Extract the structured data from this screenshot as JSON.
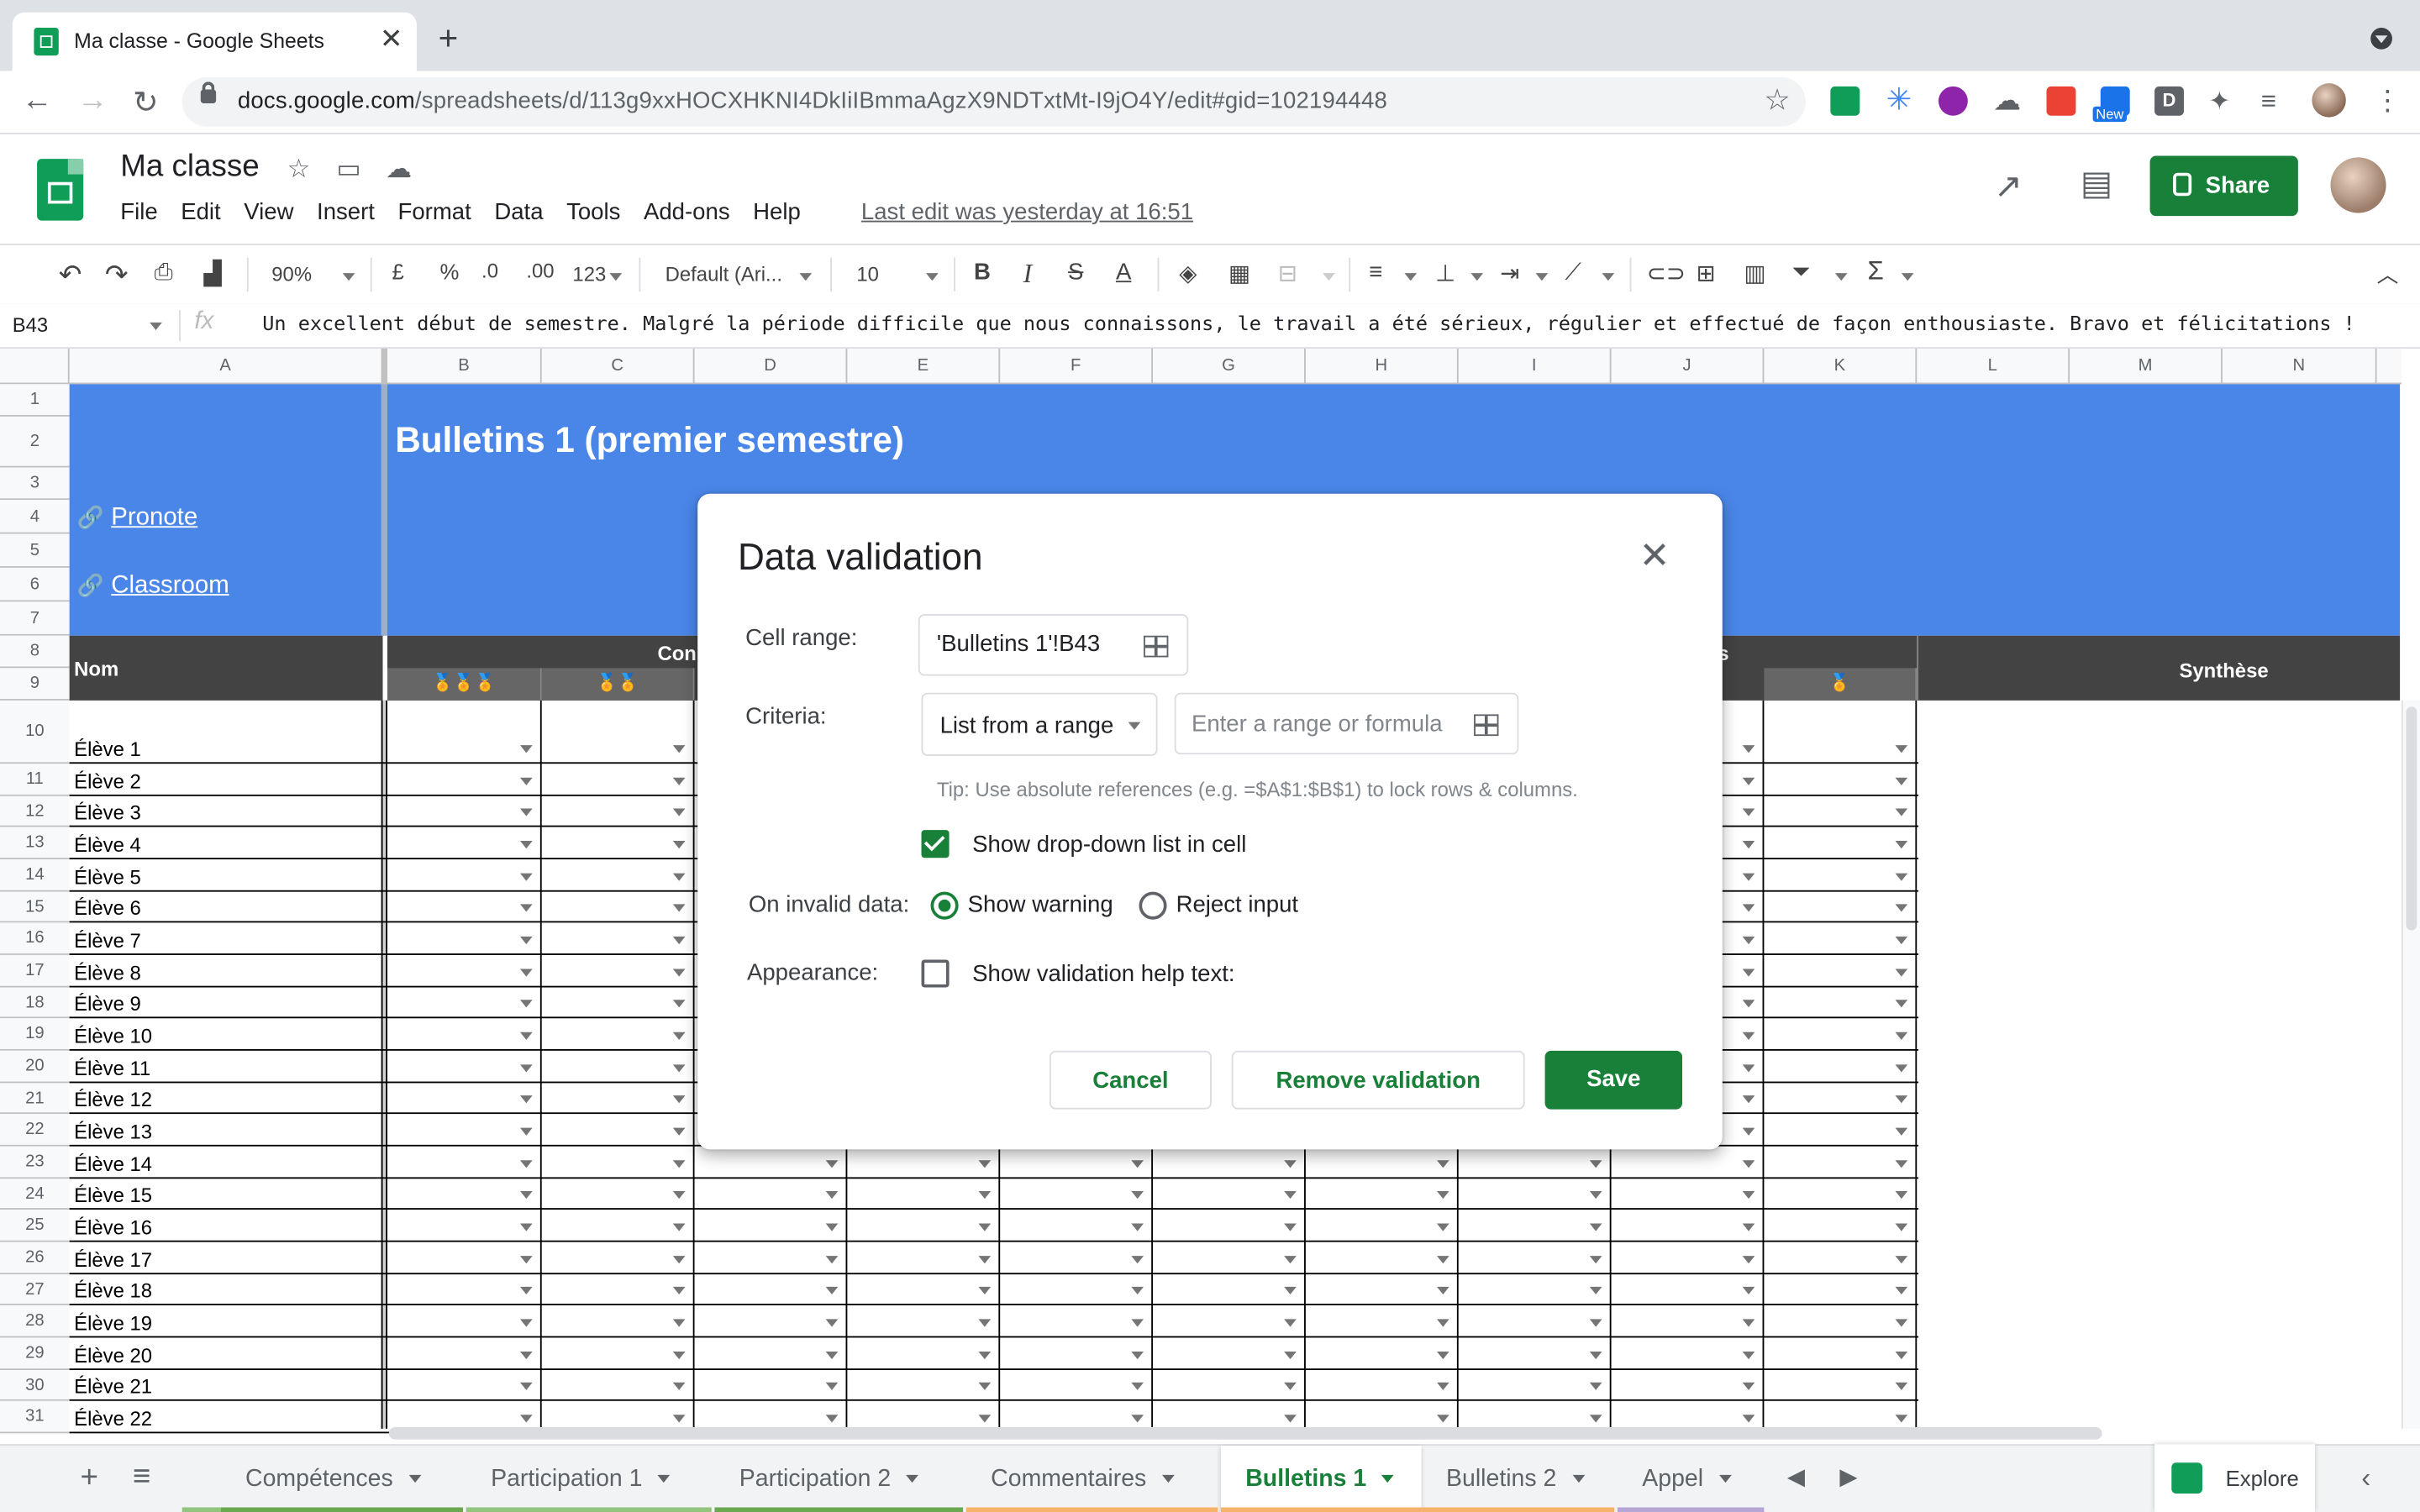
{
  "browser": {
    "tab_title": "Ma classe - Google Sheets",
    "url_host": "docs.google.com",
    "url_path": "/spreadsheets/d/113g9xxHOCXHKNI4DkIiIBmmaAgzX9NDTxtMt-I9jO4Y/edit#gid=102194448",
    "ext_new_badge": "New",
    "ext_d": "D"
  },
  "sheets": {
    "doc_title": "Ma classe",
    "menu": [
      "File",
      "Edit",
      "View",
      "Insert",
      "Format",
      "Data",
      "Tools",
      "Add-ons",
      "Help"
    ],
    "last_edit": "Last edit was yesterday at 16:51",
    "share_label": "Share",
    "toolbar": {
      "zoom": "90%",
      "currency": "£",
      "percent": "%",
      "dec_decrease": ".0",
      "dec_increase": ".00",
      "more_formats": "123",
      "font": "Default (Ari...",
      "font_size": "10"
    },
    "name_box": "B43",
    "formula": "Un excellent début de semestre. Malgré la période difficile que nous connaissons, le travail a été sérieux, régulier et effectué de façon enthousiaste. Bravo et félicitations !"
  },
  "grid": {
    "columns": [
      "A",
      "B",
      "C",
      "D",
      "E",
      "F",
      "G",
      "H",
      "I",
      "J",
      "K",
      "L",
      "M",
      "N"
    ],
    "row_numbers": [
      "1",
      "2",
      "3",
      "4",
      "5",
      "6",
      "7",
      "8",
      "9",
      "10",
      "11",
      "12",
      "13",
      "14",
      "15",
      "16",
      "17",
      "18",
      "19",
      "20",
      "21",
      "22",
      "23",
      "24",
      "25",
      "26",
      "27",
      "28",
      "29",
      "30",
      "31"
    ],
    "banner_title": "Bulletins 1 (premier semestre)",
    "link_pronote": "Pronote",
    "link_classroom": "Classroom",
    "header_nom": "Nom",
    "header_con": "Con",
    "header_s": "s",
    "header_synthese": "Synthèse",
    "medal_b": "🏅🏅🏅",
    "medal_c": "🏅🏅",
    "medal_k": "🏅",
    "students": [
      "Élève 1",
      "Élève 2",
      "Élève 3",
      "Élève 4",
      "Élève 5",
      "Élève 6",
      "Élève 7",
      "Élève 8",
      "Élève 9",
      "Élève 10",
      "Élève 11",
      "Élève 12",
      "Élève 13",
      "Élève 14",
      "Élève 15",
      "Élève 16",
      "Élève 17",
      "Élève 18",
      "Élève 19",
      "Élève 20",
      "Élève 21",
      "Élève 22"
    ]
  },
  "dialog": {
    "title": "Data validation",
    "cell_range_label": "Cell range:",
    "cell_range_value": "'Bulletins 1'!B43",
    "criteria_label": "Criteria:",
    "criteria_value": "List from a range",
    "range_placeholder": "Enter a range or formula",
    "tip": "Tip: Use absolute references (e.g. =$A$1:$B$1) to lock rows & columns.",
    "show_dropdown_label": "Show drop-down list in cell",
    "show_dropdown_checked": true,
    "invalid_label": "On invalid data:",
    "show_warning_label": "Show warning",
    "reject_input_label": "Reject input",
    "invalid_selected": "Show warning",
    "appearance_label": "Appearance:",
    "help_text_label": "Show validation help text:",
    "help_text_checked": false,
    "cancel_label": "Cancel",
    "remove_label": "Remove validation",
    "save_label": "Save"
  },
  "sheet_tabs": [
    {
      "label": "Compétences",
      "color": "#6aa84f"
    },
    {
      "label": "Participation 1",
      "color": "#93c47d"
    },
    {
      "label": "Participation 2",
      "color": "#6aa84f"
    },
    {
      "label": "Commentaires",
      "color": "#f6b26b"
    },
    {
      "label": "Bulletins 1",
      "color": "#f6b26b",
      "active": true
    },
    {
      "label": "Bulletins 2",
      "color": "#f6b26b"
    },
    {
      "label": "Appel",
      "color": "#b4a7d6"
    }
  ],
  "explore_label": "Explore",
  "colors": {
    "accent_green": "#188038",
    "banner_blue": "#4a86e8",
    "header_dark": "#434343"
  }
}
